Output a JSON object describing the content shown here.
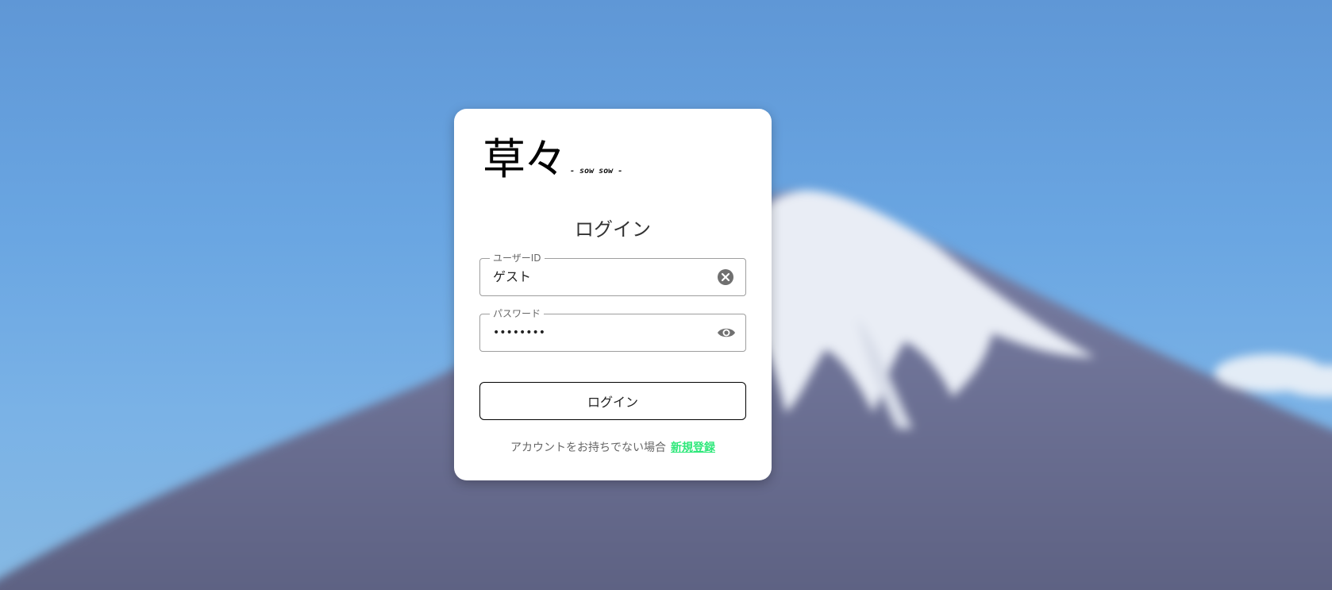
{
  "logo": {
    "kanji": "草々",
    "subtitle": "- sow sow -"
  },
  "login_title": "ログイン",
  "user_field": {
    "label": "ユーザーID",
    "value": "ゲスト",
    "icon": "clear-icon"
  },
  "password_field": {
    "label": "パスワード",
    "value": "••••••••",
    "icon": "eye-icon"
  },
  "login_button_label": "ログイン",
  "footer": {
    "text": "アカウントをお持ちでない場合",
    "link": "新規登録",
    "link_color": "#2ee87a"
  }
}
